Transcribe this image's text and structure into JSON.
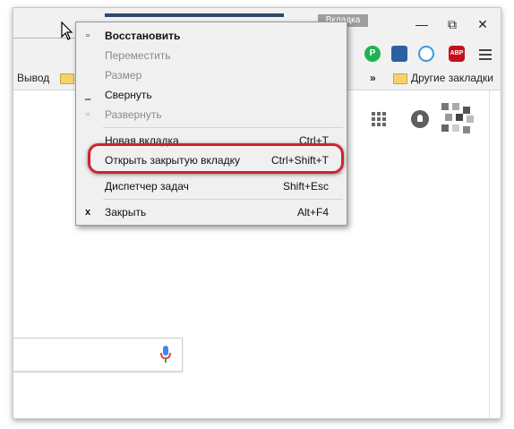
{
  "titlebar": {
    "profile_label": "Вкладка"
  },
  "window_controls": {
    "minimize": "—",
    "maximize": "⧉",
    "close": "✕"
  },
  "extensions": [
    {
      "icon": "pushbullet-icon",
      "text": "P",
      "color": "#1fb34f"
    },
    {
      "icon": "evernote-icon",
      "text": "",
      "color": "#2e5fa6"
    },
    {
      "icon": "vpn-icon",
      "text": "",
      "color": "#3a9ad9"
    },
    {
      "icon": "adblock-plus-icon",
      "text": "ABP",
      "color": "#c5101b"
    }
  ],
  "bookmarks": {
    "left_label": "Вывод",
    "overflow": "»",
    "other_label": "Другие закладки"
  },
  "context_menu": {
    "items": [
      {
        "icon": "▫",
        "label": "Восстановить",
        "shortcut": "",
        "bold": true,
        "disabled": false
      },
      {
        "icon": "",
        "label": "Переместить",
        "shortcut": "",
        "bold": false,
        "disabled": true
      },
      {
        "icon": "",
        "label": "Размер",
        "shortcut": "",
        "bold": false,
        "disabled": true
      },
      {
        "icon": "‗",
        "label": "Свернуть",
        "shortcut": "",
        "bold": false,
        "disabled": false
      },
      {
        "icon": "▫",
        "label": "Развернуть",
        "shortcut": "",
        "bold": false,
        "disabled": true
      },
      {
        "icon": "",
        "label": "Новая вкладка",
        "shortcut": "Ctrl+T",
        "bold": false,
        "disabled": false
      },
      {
        "icon": "",
        "label": "Открыть закрытую вкладку",
        "shortcut": "Ctrl+Shift+T",
        "bold": false,
        "disabled": false
      },
      {
        "icon": "",
        "label": "Диспетчер задач",
        "shortcut": "Shift+Esc",
        "bold": false,
        "disabled": false
      },
      {
        "icon": "x",
        "label": "Закрыть",
        "shortcut": "Alt+F4",
        "bold": false,
        "disabled": false
      }
    ]
  },
  "colors": {
    "highlight": "#d0232f",
    "mic_blue": "#4285f4",
    "mic_red": "#ea4335"
  }
}
